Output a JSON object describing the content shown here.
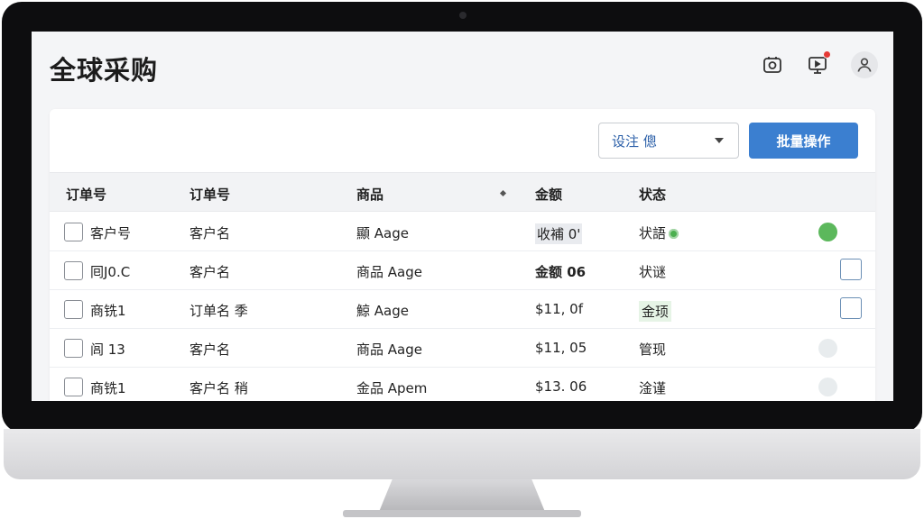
{
  "app": {
    "title": "全球采购"
  },
  "header_icons": {
    "settings": "settings-icon",
    "monitor": "monitor-icon",
    "user": "user-icon"
  },
  "toolbar": {
    "select_value": "设注 傯",
    "bulk_label": "批量操作"
  },
  "table": {
    "headers": [
      "订单号",
      "订单号",
      "商品",
      "金额",
      "状态"
    ],
    "rows": [
      {
        "c1": "客户号",
        "c2": "客户名",
        "c3": "顯 Aage",
        "c4": "收補 0'",
        "c5": "状語"
      },
      {
        "c1": "囘J0.C",
        "c2": "客户名",
        "c3": "商品 Aage",
        "c4": "金额 06",
        "c5": "状谜"
      },
      {
        "c1": "商铣1",
        "c2": "订单名 季",
        "c3": "鯨 Aage",
        "c4": "$11, 0f",
        "c5": "金顼"
      },
      {
        "c1": "闾 13",
        "c2": "客户名",
        "c3": "商品 Aage",
        "c4": "$11, 05",
        "c5": "管现"
      },
      {
        "c1": "商铣1",
        "c2": "客户名 稍",
        "c3": "金品 Apem",
        "c4": "$13. 06",
        "c5": "淦谨"
      }
    ]
  },
  "colors": {
    "accent": "#3b7fd0",
    "success": "#5cb85c",
    "notification": "#e53935"
  }
}
